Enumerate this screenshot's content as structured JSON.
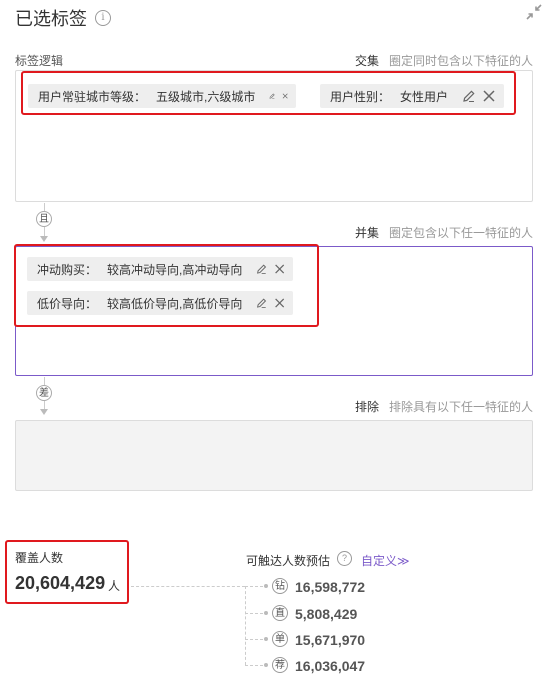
{
  "header": {
    "title": "已选标签",
    "info_glyph": "i"
  },
  "logic_label": "标签逻辑",
  "intersection": {
    "label": "交集",
    "desc": "圈定同时包含以下特征的人",
    "tags": [
      {
        "key": "用户常驻城市等级：",
        "value": "五级城市,六级城市"
      },
      {
        "key": "用户性别：",
        "value": "女性用户"
      }
    ]
  },
  "and_badge": "且",
  "union": {
    "label": "并集",
    "desc": "圈定包含以下任一特征的人",
    "tags": [
      {
        "key": "冲动购买：",
        "value": "较高冲动导向,高冲动导向"
      },
      {
        "key": "低价导向：",
        "value": "较高低价导向,高低价导向"
      }
    ]
  },
  "diff_badge": "差",
  "exclude": {
    "label": "排除",
    "desc": "排除具有以下任一特征的人"
  },
  "coverage": {
    "label": "覆盖人数",
    "value": "20,604,429",
    "unit": "人"
  },
  "reach": {
    "label": "可触达人数预估",
    "help_glyph": "?",
    "custom_link": "自定义≫",
    "channels": [
      {
        "icon": "钻",
        "value": "16,598,772"
      },
      {
        "icon": "直",
        "value": "5,808,429"
      },
      {
        "icon": "单",
        "value": "15,671,970"
      },
      {
        "icon": "荐",
        "value": "16,036,047"
      }
    ]
  }
}
